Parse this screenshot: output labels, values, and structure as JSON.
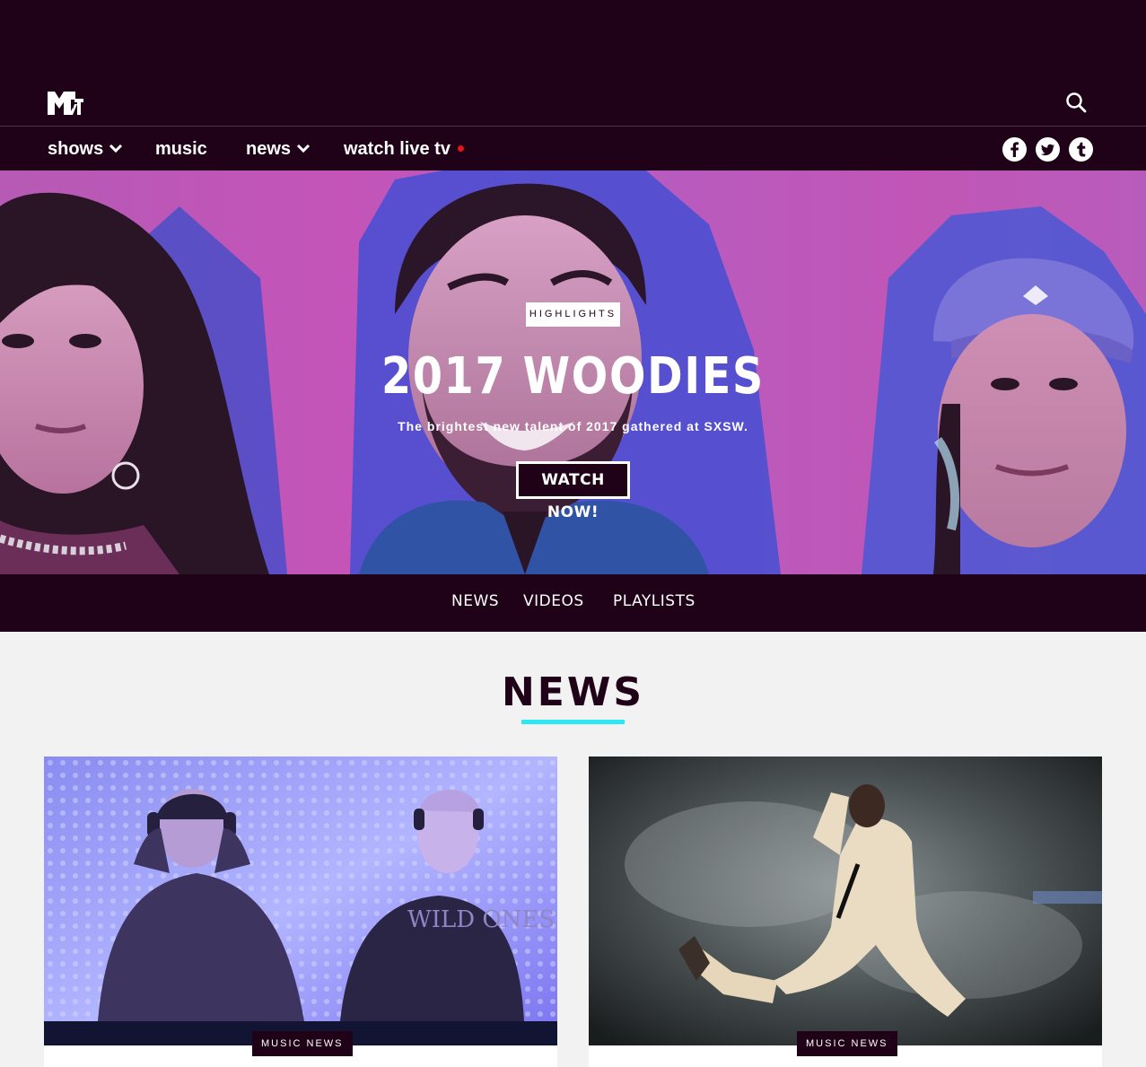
{
  "header": {
    "logo_alt": "MTV",
    "nav": [
      {
        "label": "shows",
        "has_dropdown": true
      },
      {
        "label": "music",
        "has_dropdown": false
      },
      {
        "label": "news",
        "has_dropdown": true
      },
      {
        "label": "watch live tv",
        "live": true
      }
    ],
    "social": [
      "facebook-icon",
      "twitter-icon",
      "tumblr-icon"
    ]
  },
  "hero": {
    "badge": "HIGHLIGHTS",
    "title": "2017 WOODIES",
    "subtitle": "The brightest new talent of 2017 gathered at SXSW.",
    "cta": "WATCH NOW!"
  },
  "subnav": {
    "items": [
      "NEWS",
      "VIDEOS",
      "PLAYLISTS"
    ]
  },
  "news": {
    "title": "NEWS",
    "cards": [
      {
        "tag": "MUSIC NEWS"
      },
      {
        "tag": "MUSIC NEWS"
      }
    ]
  },
  "colors": {
    "brand_dark": "#1f0218",
    "accent_cyan": "#2be8f1",
    "live_red": "#e3171b"
  }
}
